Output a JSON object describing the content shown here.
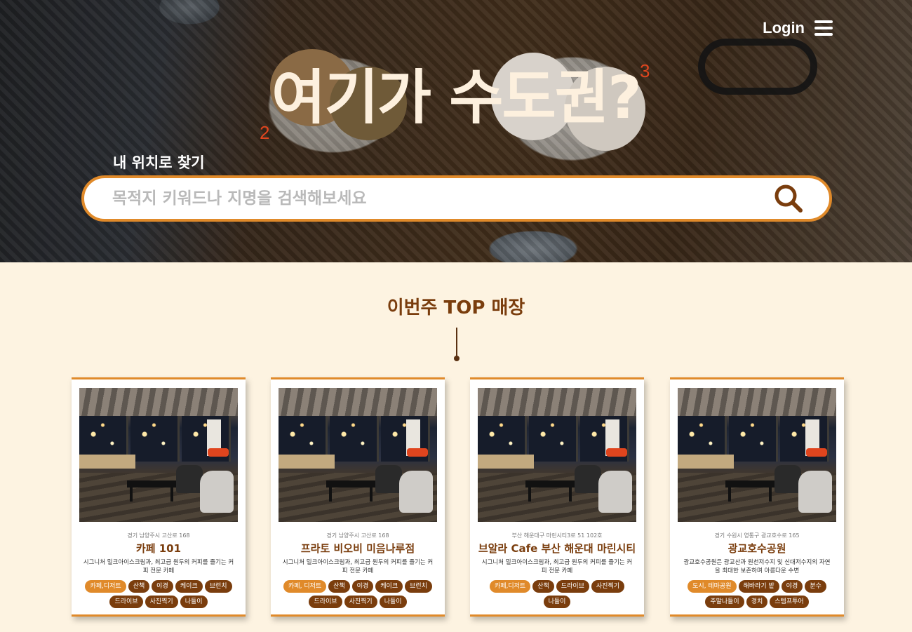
{
  "header": {
    "login_label": "Login",
    "menu_icon": "hamburger-menu-icon"
  },
  "hero": {
    "title": "여기가 수도권?",
    "marker_3": "3",
    "marker_2": "2",
    "near_me_label": "내 위치로 찾기",
    "search_placeholder": "목적지 키워드나 지명을 검색해보세요",
    "search_value": "",
    "search_icon": "search-icon"
  },
  "top_section": {
    "title": "이번주 TOP 매장"
  },
  "colors": {
    "accent": "#e08a2a",
    "brand_brown": "#7a3d0d",
    "background": "#fdf3e1",
    "marker_red": "#e0451e"
  },
  "cards": [
    {
      "address": "경기 남양주시 고산로 168",
      "name": "카페 101",
      "description": "시그니처 밀크아이스크림과, 최고급 원두의 커피를 즐기는 커피 전문 카페",
      "tags": [
        {
          "label": "카페,디저트",
          "primary": true
        },
        {
          "label": "산책",
          "primary": false
        },
        {
          "label": "야경",
          "primary": false
        },
        {
          "label": "케이크",
          "primary": false
        },
        {
          "label": "브런치",
          "primary": false
        },
        {
          "label": "드라이브",
          "primary": false
        },
        {
          "label": "사진찍기",
          "primary": false
        },
        {
          "label": "나들이",
          "primary": false
        }
      ]
    },
    {
      "address": "경기 남양주시 고산로 168",
      "name": "프라토 비오비 미음나루점",
      "description": "시그니처 밀크아이스크림과, 최고급 원두의 커피를 즐기는 커피 전문 카페",
      "tags": [
        {
          "label": "카페, 디저트",
          "primary": true
        },
        {
          "label": "산책",
          "primary": false
        },
        {
          "label": "야경",
          "primary": false
        },
        {
          "label": "케이크",
          "primary": false
        },
        {
          "label": "브런치",
          "primary": false
        },
        {
          "label": "드라이브",
          "primary": false
        },
        {
          "label": "사진찍기",
          "primary": false
        },
        {
          "label": "나들이",
          "primary": false
        }
      ]
    },
    {
      "address": "부산 해운대구 마린시티3로 51 102호",
      "name": "브알라 Cafe 부산 해운대 마린시티",
      "description": "시그니처 밀크아이스크림과, 최고급 원두의 커피를 즐기는 커피 전문 카페",
      "tags": [
        {
          "label": "카페,디저트",
          "primary": true
        },
        {
          "label": "산책",
          "primary": false
        },
        {
          "label": "드라이브",
          "primary": false
        },
        {
          "label": "사진찍기",
          "primary": false
        },
        {
          "label": "나들이",
          "primary": false
        }
      ]
    },
    {
      "address": "경기 수원시 영통구 광교호수로 165",
      "name": "광교호수공원",
      "description": "광교호수공원은 광교산과 원천저수지 및 신대저수지의 자연을 최대한 보존하며 아름다운 수변",
      "tags": [
        {
          "label": "도시, 테마공원",
          "primary": true
        },
        {
          "label": "해바라기 밭",
          "primary": false
        },
        {
          "label": "야경",
          "primary": false
        },
        {
          "label": "분수",
          "primary": false
        },
        {
          "label": "주말나들이",
          "primary": false
        },
        {
          "label": "경치",
          "primary": false
        },
        {
          "label": "스템프투어",
          "primary": false
        }
      ]
    }
  ]
}
